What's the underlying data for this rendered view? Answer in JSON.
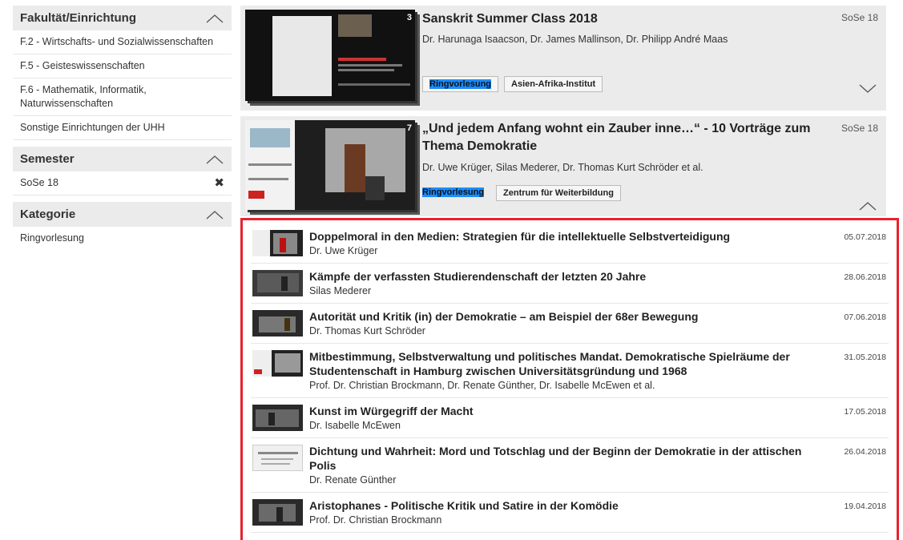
{
  "sidebar": {
    "facets": [
      {
        "title": "Fakultät/Einrichtung",
        "items": [
          "F.2 - Wirtschafts- und Sozialwissenschaften",
          "F.5 - Geisteswissenschaften",
          "F.6 - Mathematik, Informatik, Naturwissenschaften",
          "Sonstige Einrichtungen der UHH"
        ]
      },
      {
        "title": "Semester",
        "selected": "SoSe 18"
      },
      {
        "title": "Kategorie",
        "items": [
          "Ringvorlesung"
        ]
      }
    ]
  },
  "courses": [
    {
      "title": "Sanskrit Summer Class 2018",
      "semester": "SoSe 18",
      "authors": "Dr. Harunaga Isaacson, Dr. James Mallinson, Dr. Philipp André Maas",
      "count": "3",
      "badges": [
        "Ringvorlesung",
        "Asien-Afrika-Institut"
      ]
    },
    {
      "title": "„Und jedem Anfang wohnt ein Zauber inne…“ - 10 Vorträge zum Thema Demokratie",
      "semester": "SoSe 18",
      "authors": "Dr. Uwe Krüger, Silas Mederer, Dr. Thomas Kurt Schröder et al.",
      "count": "7",
      "badges": [
        "Ringvorlesung",
        "Zentrum für Weiterbildung"
      ]
    }
  ],
  "episodes": [
    {
      "title": "Doppelmoral in den Medien: Strategien für die intellektuelle Selbstverteidigung",
      "author": "Dr. Uwe Krüger",
      "date": "05.07.2018"
    },
    {
      "title": "Kämpfe der verfassten Studierendenschaft der letzten 20 Jahre",
      "author": "Silas Mederer",
      "date": "28.06.2018"
    },
    {
      "title": "Autorität und Kritik (in) der Demokratie – am Beispiel der 68er Bewegung",
      "author": "Dr. Thomas Kurt Schröder",
      "date": "07.06.2018"
    },
    {
      "title": "Mitbestimmung, Selbstverwaltung und politisches Mandat. Demokratische Spielräume der Studentenschaft in Hamburg zwischen Universitätsgründung und 1968",
      "author": "Prof. Dr. Christian Brockmann, Dr. Renate Günther, Dr. Isabelle McEwen et al.",
      "date": "31.05.2018"
    },
    {
      "title": "Kunst im Würgegriff der Macht",
      "author": "Dr. Isabelle McEwen",
      "date": "17.05.2018"
    },
    {
      "title": "Dichtung und Wahrheit: Mord und Totschlag und der Beginn der Demokratie in der attischen Polis",
      "author": "Dr. Renate Günther",
      "date": "26.04.2018"
    },
    {
      "title": "Aristophanes - Politische Kritik und Satire in der Komödie",
      "author": "Prof. Dr. Christian Brockmann",
      "date": "19.04.2018"
    }
  ],
  "colors": {
    "highlight_border": "#e8222d",
    "badge_highlight": "#1a8cff",
    "panel_bg": "#ebebeb"
  }
}
